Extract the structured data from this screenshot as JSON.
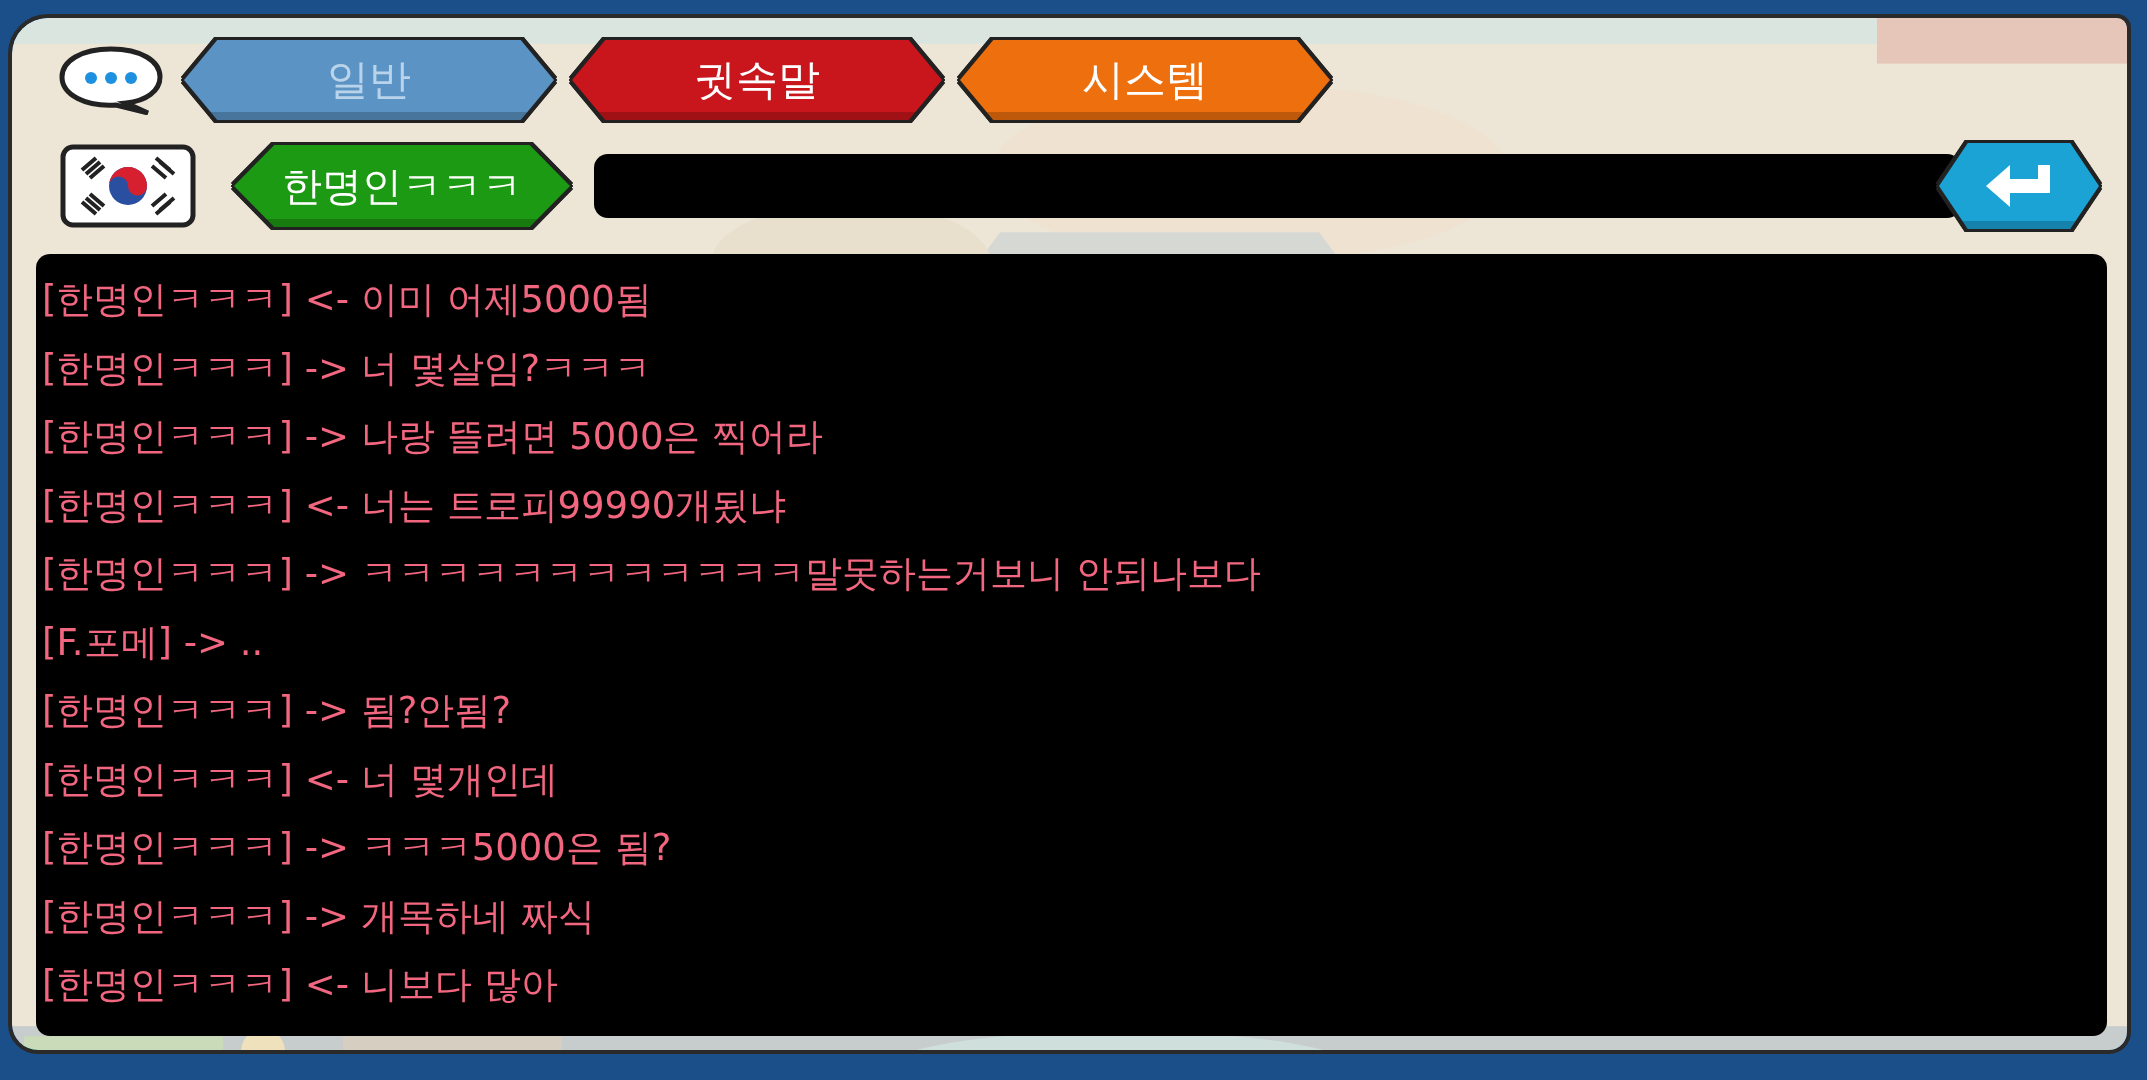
{
  "tabs": [
    {
      "label": "일반",
      "color": "#5b93c4",
      "dimmed": true
    },
    {
      "label": "귓속말",
      "color": "#c8161c",
      "dimmed": false
    },
    {
      "label": "시스템",
      "color": "#ee6f0e",
      "dimmed": false
    }
  ],
  "recipient": {
    "label": "한명인ㅋㅋㅋ"
  },
  "messages": [
    {
      "text": "[한명인ㅋㅋㅋ] <- 이미 어제5000됨"
    },
    {
      "text": "[한명인ㅋㅋㅋ] -> 너 몇살임?ㅋㅋㅋ"
    },
    {
      "text": "[한명인ㅋㅋㅋ] -> 나랑 뜰려면 5000은 찍어라"
    },
    {
      "text": "[한명인ㅋㅋㅋ] <- 너는 트로피99990개됬냐"
    },
    {
      "text": "[한명인ㅋㅋㅋ] -> ㅋㅋㅋㅋㅋㅋㅋㅋㅋㅋㅋㅋ말못하는거보니 안되나보다"
    },
    {
      "text": "[F.포메] -> .."
    },
    {
      "text": "[한명인ㅋㅋㅋ] -> 됨?안됨?"
    },
    {
      "text": "[한명인ㅋㅋㅋ] <- 너 몇개인데"
    },
    {
      "text": "[한명인ㅋㅋㅋ] -> ㅋㅋㅋ5000은 됨?"
    },
    {
      "text": "[한명인ㅋㅋㅋ] -> 개목하네 짜식"
    },
    {
      "text": "[한명인ㅋㅋㅋ] <- 니보다 많아"
    }
  ]
}
